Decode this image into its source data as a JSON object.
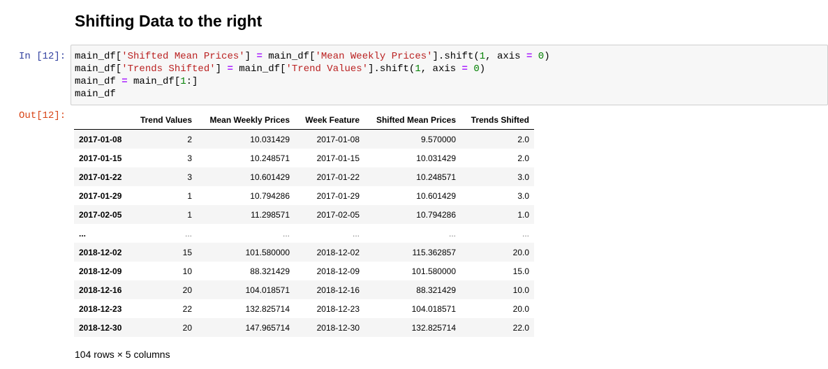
{
  "heading": "Shifting Data to the right",
  "cell": {
    "in_prompt": "In [12]:",
    "out_prompt": "Out[12]:",
    "code_lines": [
      "main_df['Shifted Mean Prices'] = main_df['Mean Weekly Prices'].shift(1, axis = 0)",
      "main_df['Trends Shifted'] = main_df['Trend Values'].shift(1, axis = 0)",
      "main_df = main_df[1:]",
      "main_df"
    ]
  },
  "table": {
    "columns": [
      "",
      "Trend Values",
      "Mean Weekly Prices",
      "Week Feature",
      "Shifted Mean Prices",
      "Trends Shifted"
    ],
    "rows": [
      [
        "2017-01-08",
        "2",
        "10.031429",
        "2017-01-08",
        "9.570000",
        "2.0"
      ],
      [
        "2017-01-15",
        "3",
        "10.248571",
        "2017-01-15",
        "10.031429",
        "2.0"
      ],
      [
        "2017-01-22",
        "3",
        "10.601429",
        "2017-01-22",
        "10.248571",
        "3.0"
      ],
      [
        "2017-01-29",
        "1",
        "10.794286",
        "2017-01-29",
        "10.601429",
        "3.0"
      ],
      [
        "2017-02-05",
        "1",
        "11.298571",
        "2017-02-05",
        "10.794286",
        "1.0"
      ],
      [
        "...",
        "...",
        "...",
        "...",
        "...",
        "..."
      ],
      [
        "2018-12-02",
        "15",
        "101.580000",
        "2018-12-02",
        "115.362857",
        "20.0"
      ],
      [
        "2018-12-09",
        "10",
        "88.321429",
        "2018-12-09",
        "101.580000",
        "15.0"
      ],
      [
        "2018-12-16",
        "20",
        "104.018571",
        "2018-12-16",
        "88.321429",
        "10.0"
      ],
      [
        "2018-12-23",
        "22",
        "132.825714",
        "2018-12-23",
        "104.018571",
        "20.0"
      ],
      [
        "2018-12-30",
        "20",
        "147.965714",
        "2018-12-30",
        "132.825714",
        "22.0"
      ]
    ],
    "footer": "104 rows × 5 columns"
  }
}
